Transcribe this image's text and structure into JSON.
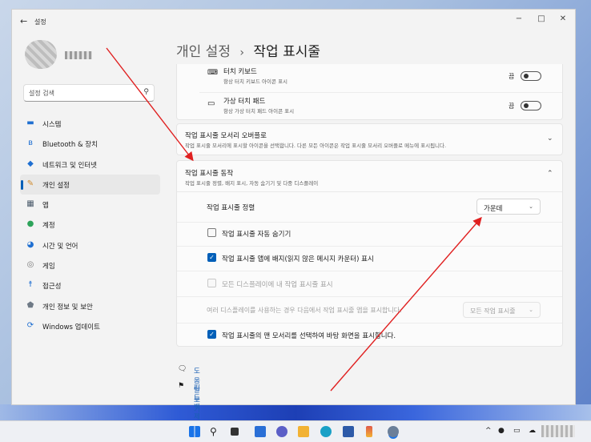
{
  "window": {
    "app_title": "설정",
    "back": "←",
    "minimize": "−",
    "maximize": "□",
    "close": "✕"
  },
  "search": {
    "placeholder": "설정 검색",
    "icon": "search-icon"
  },
  "sidebar": {
    "items": [
      {
        "label": "시스템",
        "icon": "monitor-icon",
        "color": "#1f6fd1"
      },
      {
        "label": "Bluetooth & 장치",
        "icon": "bluetooth-icon",
        "color": "#1f6fd1"
      },
      {
        "label": "네트워크 및 인터넷",
        "icon": "wifi-icon",
        "color": "#1f6fd1"
      },
      {
        "label": "개인 설정",
        "icon": "pen-icon",
        "color": "#d08a2c"
      },
      {
        "label": "앱",
        "icon": "apps-icon",
        "color": "#4a5a6a"
      },
      {
        "label": "계정",
        "icon": "person-icon",
        "color": "#2da35a"
      },
      {
        "label": "시간 및 언어",
        "icon": "globe-clock-icon",
        "color": "#1f6fd1"
      },
      {
        "label": "게임",
        "icon": "gamepad-icon",
        "color": "#777777"
      },
      {
        "label": "접근성",
        "icon": "accessibility-icon",
        "color": "#1f6fd1"
      },
      {
        "label": "개인 정보 및 보안",
        "icon": "shield-icon",
        "color": "#6f7a86"
      },
      {
        "label": "Windows 업데이트",
        "icon": "update-icon",
        "color": "#1f6fd1"
      }
    ],
    "active_index": 3
  },
  "breadcrumb": {
    "parent": "개인 설정",
    "sep": "›",
    "current": "작업 표시줄"
  },
  "taskbar_icons_rows": [
    {
      "title": "터치 키보드",
      "subtitle": "항상 터치 키보드 아이콘 표시",
      "icon": "keyboard-icon",
      "toggle_label": "끔",
      "on": false
    },
    {
      "title": "가상 터치 패드",
      "subtitle": "항상 가상 터치 패드 아이콘 표시",
      "icon": "touchpad-icon",
      "toggle_label": "끔",
      "on": false
    }
  ],
  "overflow": {
    "title": "작업 표시줄 모서리 오버플로",
    "subtitle": "작업 표시줄 모서리에 표시할 아이콘을 선택합니다. 다른 모든 아이콘은 작업 표시줄 모서리 오버플로 메뉴에 표시됩니다."
  },
  "behaviors": {
    "title": "작업 표시줄 동작",
    "subtitle": "작업 표시줄 정렬, 배지 표시, 자동 숨기기 및 다중 디스플레이",
    "alignment_label": "작업 표시줄 정렬",
    "alignment_value": "가운데",
    "options": [
      {
        "label": "작업 표시줄 자동 숨기기",
        "checked": false,
        "disabled": false
      },
      {
        "label": "작업 표시줄 앱에 배지(읽지 않은 메시지 카운터) 표시",
        "checked": true,
        "disabled": false
      },
      {
        "label": "모든 디스플레이에 내 작업 표시줄 표시",
        "checked": false,
        "disabled": true
      }
    ],
    "multi_display_label": "여러 디스플레이를 사용하는 경우 다음에서 작업 표시줄 앱을 표시합니다.",
    "multi_display_value": "모든 작업 표시줄",
    "far_corner": {
      "label": "작업 표시줄의 맨 모서리를 선택하여 바탕 화면을 표시합니다.",
      "checked": true
    }
  },
  "links": [
    {
      "label": "도움말 보기",
      "icon": "help-icon"
    },
    {
      "label": "피드백 제공",
      "icon": "feedback-icon"
    }
  ],
  "taskbar": {
    "apps": [
      "windows-start-icon",
      "search-icon",
      "task-view-icon",
      "widgets-icon",
      "chat-icon",
      "file-explorer-icon",
      "edge-icon",
      "store-icon",
      "paint-icon",
      "settings-icon"
    ],
    "tray": [
      "chevron-up-icon",
      "notification-icon",
      "display-icon",
      "cloud-icon"
    ]
  },
  "colors": {
    "accent": "#005fb8",
    "link": "#1a5fb4",
    "annotation": "#e02020"
  }
}
